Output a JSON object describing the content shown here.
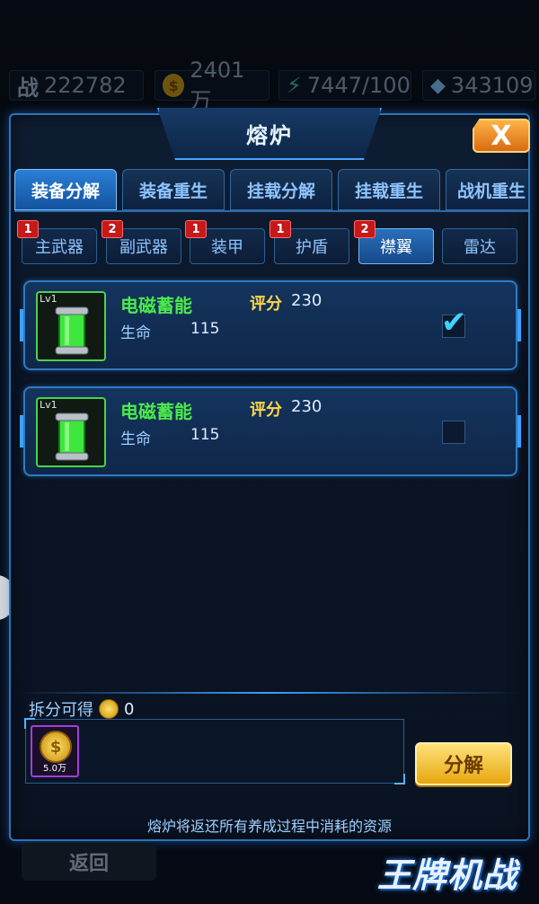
{
  "resources": {
    "power_icon": "战",
    "power": "222782",
    "gold": "2401万",
    "energy": "7447/100",
    "gems": "343109"
  },
  "title": "熔炉",
  "close_label": "X",
  "tabs": [
    "装备分解",
    "装备重生",
    "挂载分解",
    "挂载重生",
    "战机重生"
  ],
  "subtabs": [
    {
      "label": "主武器",
      "badge": "1"
    },
    {
      "label": "副武器",
      "badge": "2"
    },
    {
      "label": "装甲",
      "badge": "1"
    },
    {
      "label": "护盾",
      "badge": "1"
    },
    {
      "label": "襟翼",
      "badge": "2"
    },
    {
      "label": "雷达",
      "badge": ""
    }
  ],
  "items": [
    {
      "level": "Lv1",
      "name": "电磁蓄能",
      "score_label": "评分",
      "score": "230",
      "stat_label": "生命",
      "stat_value": "115",
      "checked": true
    },
    {
      "level": "Lv1",
      "name": "电磁蓄能",
      "score_label": "评分",
      "score": "230",
      "stat_label": "生命",
      "stat_value": "115",
      "checked": false
    }
  ],
  "yield": {
    "label": "拆分可得",
    "value": "0"
  },
  "reward": {
    "amount": "5.0万"
  },
  "decompose_label": "分解",
  "footer_note": "熔炉将返还所有养成过程中消耗的资源",
  "back_label": "返回",
  "logo_text": "王牌机战",
  "colors": {
    "accent": "#2b75b8",
    "item_name": "#4bea4b",
    "score": "#ffd84a",
    "button": "#e7a70f"
  }
}
